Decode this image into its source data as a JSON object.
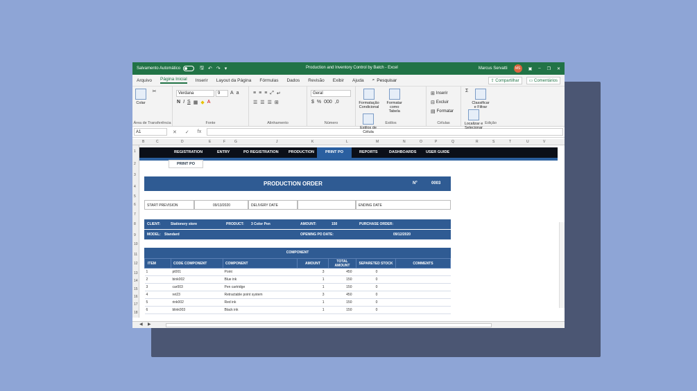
{
  "titlebar": {
    "autosave_label": "Salvamento Automático",
    "document_title": "Production and Inventory Control by Batch  -  Excel",
    "user_name": "Marcus Servatti",
    "user_initials": "MS"
  },
  "menu": {
    "tabs": [
      "Arquivo",
      "Página Inicial",
      "Inserir",
      "Layout da Página",
      "Fórmulas",
      "Dados",
      "Revisão",
      "Exibir",
      "Ajuda"
    ],
    "search_label": "Pesquisar",
    "share_label": "Compartilhar",
    "comments_label": "Comentários"
  },
  "ribbon": {
    "clipboard": {
      "paste": "Colar",
      "group": "Área de Transferência"
    },
    "font": {
      "family": "Verdana",
      "size": "9",
      "group": "Fonte",
      "bold": "N",
      "italic": "I",
      "underline": "S"
    },
    "alignment": {
      "group": "Alinhamento"
    },
    "number": {
      "format": "Geral",
      "group": "Número"
    },
    "styles": {
      "conditional": "Formatação Condicional",
      "table": "Formatar como Tabela",
      "cell": "Estilos de Célula",
      "group": "Estilos"
    },
    "cells": {
      "insert": "Inserir",
      "delete": "Excluir",
      "format": "Formatar",
      "group": "Células"
    },
    "editing": {
      "sort": "Classificar e Filtrar",
      "find": "Localizar e Selecionar",
      "group": "Edição"
    }
  },
  "formula": {
    "cell_ref": "A1",
    "fx": "fx"
  },
  "sheet": {
    "columns": [
      "B",
      "C",
      "D",
      "E",
      "F",
      "G",
      "J",
      "K",
      "L",
      "M",
      "N",
      "O",
      "P",
      "Q",
      "R",
      "S",
      "T",
      "U",
      "V"
    ],
    "rows": [
      "1",
      "2",
      "3",
      "4",
      "5",
      "6",
      "7",
      "8",
      "9",
      "10",
      "11",
      "12",
      "13",
      "14",
      "15",
      "16",
      "17",
      "18"
    ],
    "nav": [
      "REGISTRATION",
      "ENTRY",
      "PO REGISTRATION",
      "PRODUCTION",
      "PRINT PO",
      "REPORTS",
      "DASHBOARDS",
      "USER GUIDE"
    ],
    "active_nav": "PRINT PO",
    "subtab": "PRINT PO",
    "order_title": "PRODUCTION ORDER",
    "order_no_label": "Nº",
    "order_no": "0003",
    "start_label": "START PREVISION",
    "start_value": "09/13/2020",
    "delivery_label": "DELIVERY DATE",
    "ending_label": "ENDING DATE",
    "client_label": "CLIENT:",
    "client_value": "Stationery store",
    "product_label": "PRODUCT:",
    "product_value": "3 Color Pen",
    "amount_label": "AMOUNT:",
    "amount_value": "150",
    "purchase_label": "PURCHASE ORDER:",
    "model_label": "MODEL:",
    "model_value": "Standard",
    "opening_label": "OPENING PO DATE:",
    "opening_value": "09/12/2020",
    "component_title": "COMPONENT",
    "table_headers": [
      "ITEM",
      "CODE COMPONENT",
      "COMPONENT",
      "AMOUNT",
      "TOTAL AMOUNT",
      "SEPARETED STOCK",
      "COMMENTS"
    ],
    "table_rows": [
      [
        "1",
        "pt001",
        "Point",
        "3",
        "450",
        "0",
        ""
      ],
      [
        "2",
        "bink002",
        "Blue ink",
        "1",
        "150",
        "0",
        ""
      ],
      [
        "3",
        "car003",
        "Pen cartridge",
        "1",
        "150",
        "0",
        ""
      ],
      [
        "4",
        "ret23",
        "Retractable point system",
        "3",
        "450",
        "0",
        ""
      ],
      [
        "5",
        "rink002",
        "Red ink",
        "1",
        "150",
        "0",
        ""
      ],
      [
        "6",
        "blink003",
        "Black ink",
        "1",
        "150",
        "0",
        ""
      ]
    ]
  }
}
